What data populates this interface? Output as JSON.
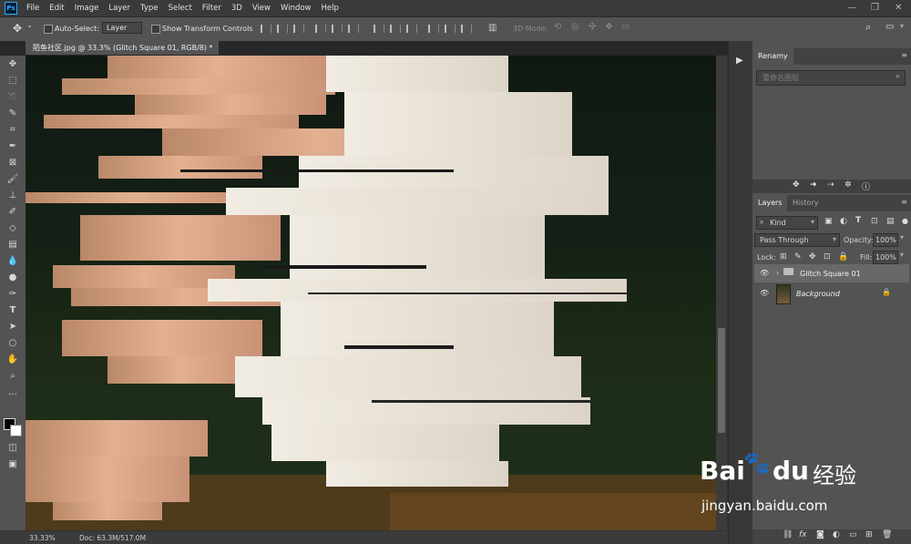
{
  "app": {
    "logo": "Ps"
  },
  "menu": [
    "File",
    "Edit",
    "Image",
    "Layer",
    "Type",
    "Select",
    "Filter",
    "3D",
    "View",
    "Window",
    "Help"
  ],
  "options": {
    "auto_select_label": "Auto-Select:",
    "auto_select_value": "Layer",
    "transform_label": "Show Transform Controls",
    "mode3d_label": "3D Mode:"
  },
  "document": {
    "tab_title": "陌鱼社区.jpg @ 33.3% (Glitch Square 01, RGB/8) *"
  },
  "status": {
    "zoom": "33.33%",
    "doc": "Doc: 63.3M/517.0M"
  },
  "renamy": {
    "title": "Renamy",
    "placeholder": "重命名图层"
  },
  "layers_panel": {
    "tabs": [
      "Layers",
      "History"
    ],
    "filter": "Kind",
    "blend_mode": "Pass Through",
    "opacity_label": "Opacity:",
    "opacity_value": "100%",
    "lock_label": "Lock:",
    "fill_label": "Fill:",
    "fill_value": "100%",
    "layers": [
      {
        "name": "Glitch Square 01",
        "type": "group",
        "visible": true,
        "selected": true
      },
      {
        "name": "Background",
        "type": "image",
        "visible": true,
        "locked": true
      }
    ]
  },
  "watermark": {
    "brand": "Bai",
    "brand2": "du",
    "cn": "经验",
    "url": "jingyan.baidu.com"
  },
  "colors": {
    "accent": "#31a8ff",
    "panel": "#535353",
    "dark": "#323232",
    "skin": "#d9a585",
    "cloth": "#e9e2d6"
  }
}
